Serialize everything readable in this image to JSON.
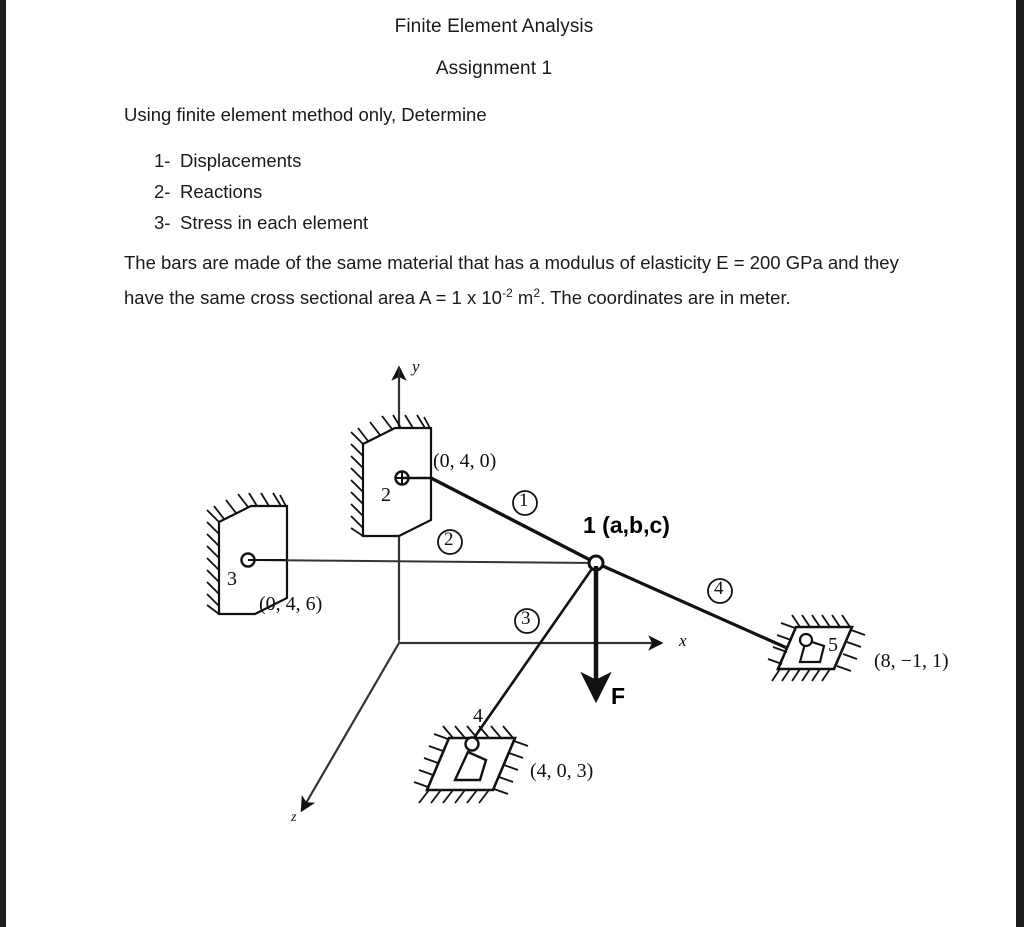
{
  "document": {
    "title_main": "Finite Element Analysis",
    "title_sub": "Assignment 1",
    "intro_line": "Using finite element method only, Determine",
    "tasks": [
      {
        "number": "1-",
        "label": "Displacements"
      },
      {
        "number": "2-",
        "label": "Reactions"
      },
      {
        "number": "3-",
        "label": "Stress in each element"
      }
    ],
    "material_paragraph_part1": "The bars are made of the same material that has a modulus of elasticity E = 200 GPa and they have the same cross sectional area A = 1 x 10",
    "material_exponent_1": "-2",
    "material_paragraph_part2": " m",
    "material_exponent_2": "2",
    "material_paragraph_part3": ". The coordinates are in meter."
  },
  "figure": {
    "caption_node1": "1 (a,b,c)",
    "force_label": "F",
    "axes": {
      "x_label": "x",
      "y_label": "y",
      "z_label": "z"
    },
    "nodes": [
      {
        "id": "1",
        "label": "1 (a,b,c)",
        "coords": "",
        "type": "free-node"
      },
      {
        "id": "2",
        "label": "2",
        "coords": "(0, 4, 0)",
        "type": "wall-support"
      },
      {
        "id": "3",
        "label": "3",
        "coords": "(0, 4, 6)",
        "type": "wall-support"
      },
      {
        "id": "4",
        "label": "4",
        "coords": "(4, 0, 3)",
        "type": "ground-support"
      },
      {
        "id": "5",
        "label": "5",
        "coords": "(8, −1, 1)",
        "type": "ground-support"
      }
    ],
    "elements": [
      {
        "id": "1",
        "label": "①",
        "from": "2",
        "to": "1"
      },
      {
        "id": "2",
        "label": "②",
        "from": "3",
        "to": "1"
      },
      {
        "id": "3",
        "label": "③",
        "from": "4",
        "to": "1"
      },
      {
        "id": "4",
        "label": "④",
        "from": "1",
        "to": "5"
      }
    ],
    "colors": {
      "line": "#111111",
      "text": "#111111",
      "background": "#ffffff"
    }
  }
}
